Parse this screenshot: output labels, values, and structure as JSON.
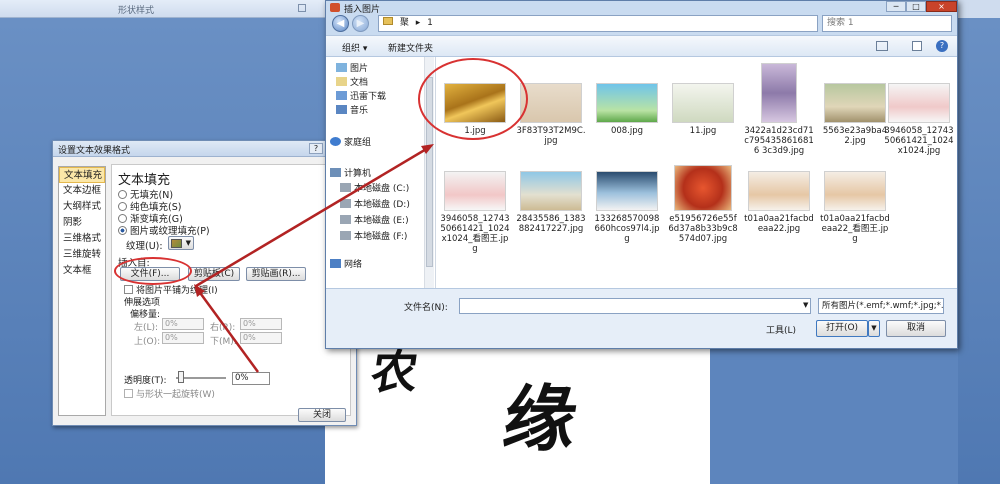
{
  "background": {
    "ribbon_label": "形状样式",
    "calligraphy_1": "农",
    "calligraphy_2": "缘"
  },
  "format_dialog": {
    "title": "设置文本效果格式",
    "help": "?",
    "close_x": "×",
    "nav_items": [
      "文本填充",
      "文本边框",
      "大纲样式",
      "阴影",
      "三维格式",
      "三维旋转",
      "文本框"
    ],
    "heading": "文本填充",
    "options": [
      "无填充(N)",
      "纯色填充(S)",
      "渐变填充(G)",
      "图片或纹理填充(P)"
    ],
    "texture_label": "纹理(U):",
    "insert_from": "插入自:",
    "file_button": "文件(F)...",
    "clipboard_button": "剪贴板(C)",
    "clipart_button": "剪贴画(R)...",
    "tile_checkbox": "将图片平铺为纹理(I)",
    "stretch_options": "伸展选项",
    "offsets": "偏移量:",
    "left_label": "左(L):",
    "right_label": "右(R):",
    "top_label": "上(O):",
    "bottom_label": "下(M):",
    "offset_value": "0%",
    "transparency_label": "透明度(T):",
    "transparency_value": "0%",
    "rotate_checkbox": "与形状一起旋转(W)",
    "close_button": "关闭"
  },
  "open_dialog": {
    "title": "插入图片",
    "win_min": "─",
    "win_max": "□",
    "win_close": "×",
    "back": "◀",
    "forward": "▶",
    "address": [
      "聚",
      "1"
    ],
    "search_placeholder": "搜索 1",
    "organize": "组织 ▾",
    "new_folder": "新建文件夹",
    "nav": {
      "libraries": [
        "图片",
        "文档",
        "迅雷下载",
        "音乐"
      ],
      "homegroup": "家庭组",
      "computer": "计算机",
      "drives": [
        "本地磁盘 (C:)",
        "本地磁盘 (D:)",
        "本地磁盘 (E:)",
        "本地磁盘 (F:)"
      ],
      "network": "网络"
    },
    "files": [
      "1.jpg",
      "3F83T93T2M9C.jpg",
      "008.jpg",
      "11.jpg",
      "3422a1d23cd71c7954358616816 3c3d9.jpg",
      "5563e23a9ba42.jpg",
      "3946058_1274350661421_1024x1024.jpg",
      "3946058_1274350661421_1024x1024_看图王.jpg",
      "28435586_1383882417227.jpg",
      "133268570098660hcos97l4.jpg",
      "e51956726e55f6d37a8b33b9c8574d07.jpg",
      "t01a0aa21facbdeaa22.jpg",
      "t01a0aa21facbdeaa22_看图王.jpg"
    ],
    "filename_label": "文件名(N):",
    "filename_value": "",
    "filter": "所有图片(*.emf;*.wmf;*.jpg;*.jp",
    "tools": "工具(L)",
    "open_button": "打开(O)",
    "cancel_button": "取消"
  }
}
